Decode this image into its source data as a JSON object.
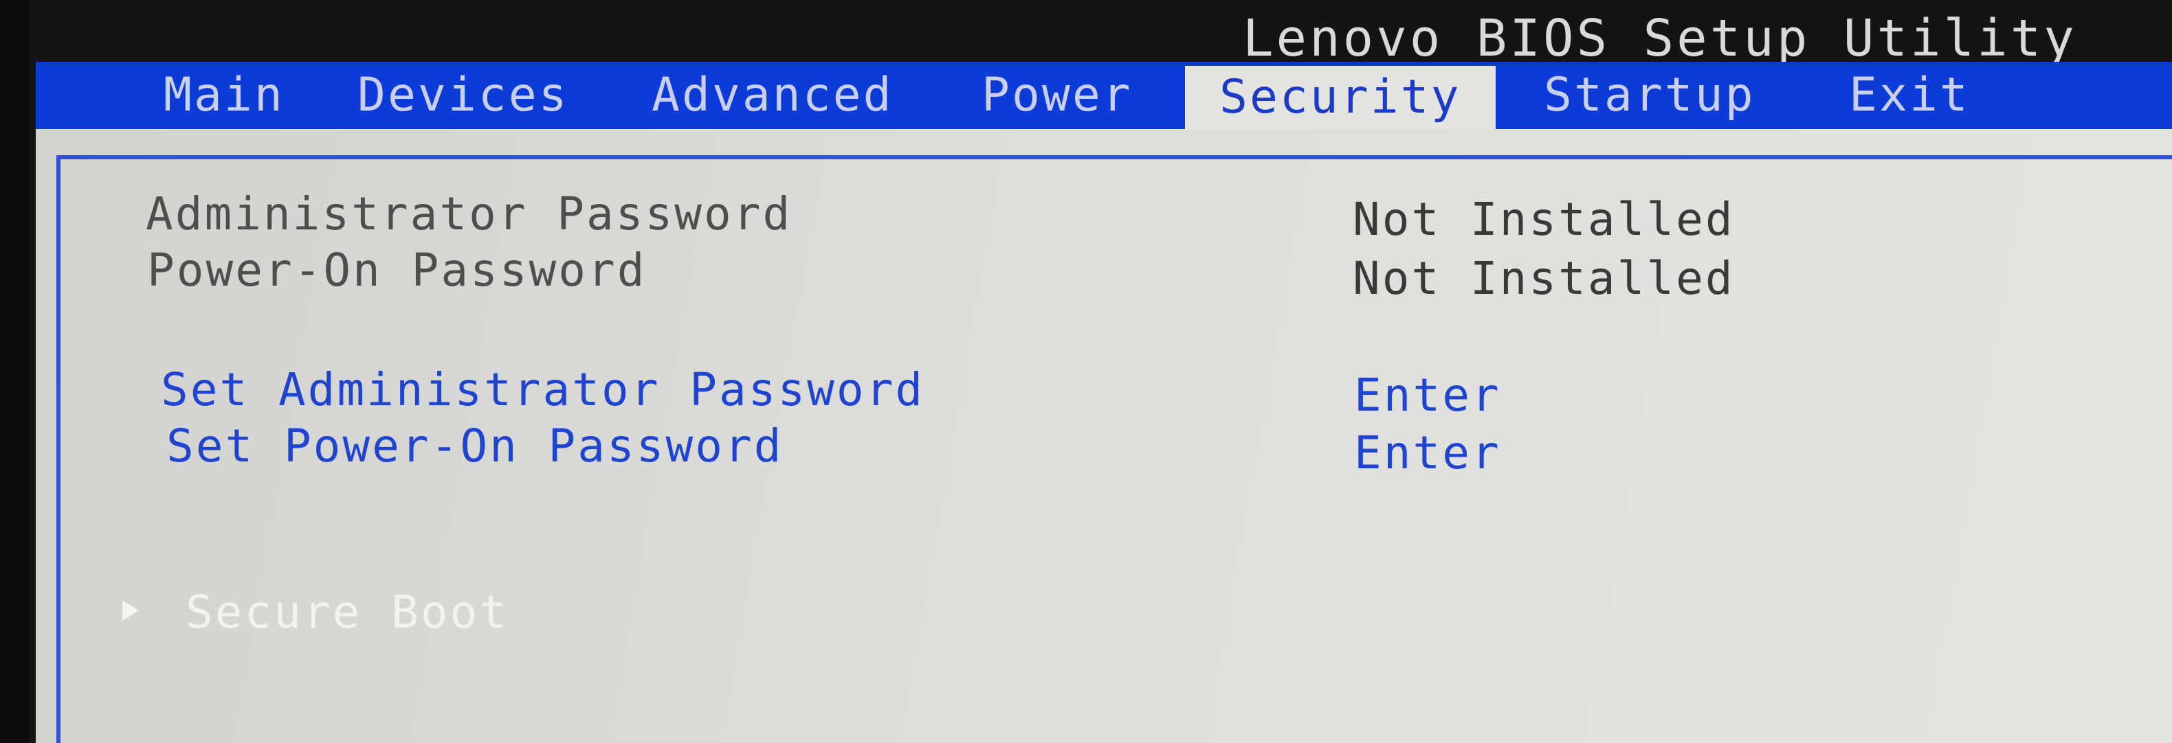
{
  "window": {
    "title": "Lenovo BIOS Setup Utility"
  },
  "menu": {
    "tabs": [
      {
        "label": "Main"
      },
      {
        "label": "Devices"
      },
      {
        "label": "Advanced"
      },
      {
        "label": "Power"
      },
      {
        "label": "Security",
        "active": true
      },
      {
        "label": "Startup"
      },
      {
        "label": "Exit"
      }
    ]
  },
  "security": {
    "rows": [
      {
        "label": "Administrator Password",
        "value": "Not Installed"
      },
      {
        "label": "Power-On Password",
        "value": "Not Installed"
      },
      {
        "label": "Set Administrator Password",
        "value": "Enter"
      },
      {
        "label": "Set Power-On Password",
        "value": "Enter"
      }
    ],
    "submenu": {
      "label": "Secure Boot",
      "icon": "triangle-right-icon"
    }
  },
  "colors": {
    "menubar": "#0d3bd8",
    "panel": "#e4e4e2",
    "accent_text": "#1e44d0",
    "title_text": "#d9d9d9"
  }
}
